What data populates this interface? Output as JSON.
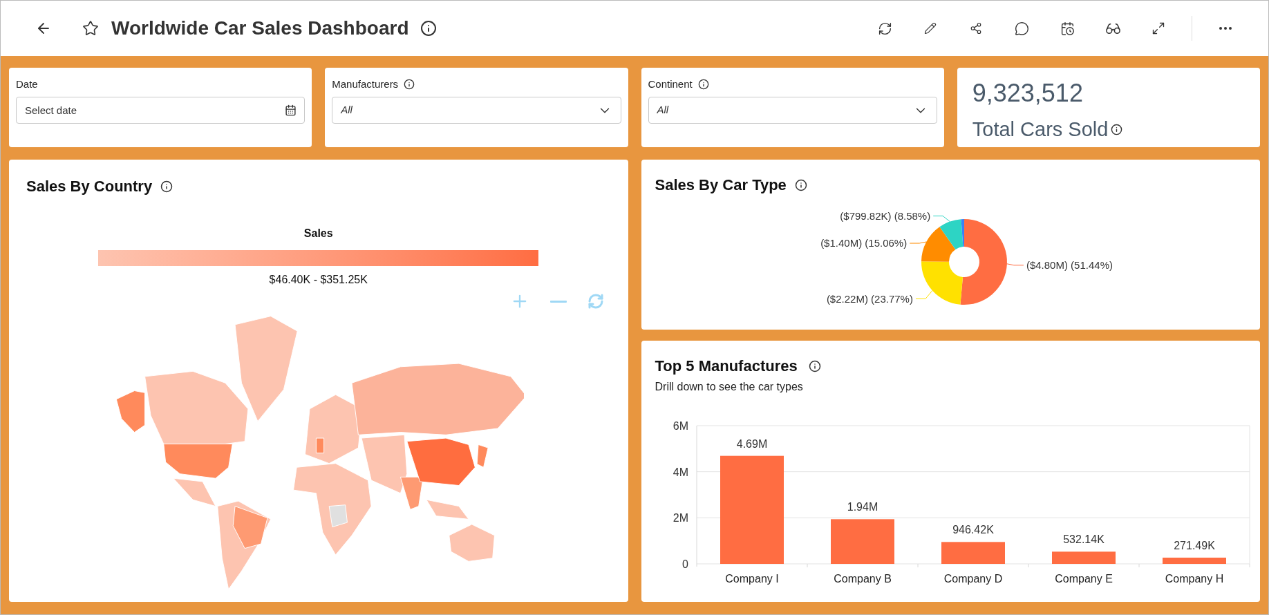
{
  "header": {
    "title": "Worldwide Car Sales Dashboard",
    "favorite": false
  },
  "filters": [
    {
      "kind": "date",
      "label": "Date",
      "placeholder": "Select date",
      "info": false
    },
    {
      "kind": "dropdown",
      "label": "Manufacturers",
      "value": "All",
      "info": true
    },
    {
      "kind": "dropdown",
      "label": "Continent",
      "value": "All",
      "info": true
    }
  ],
  "kpi": {
    "value": "9,323,512",
    "label": "Total Cars Sold"
  },
  "map_card": {
    "title": "Sales By Country",
    "legend_title": "Sales",
    "legend_range": "$46.40K - $351.25K"
  },
  "donut_card": {
    "title": "Sales By Car Type",
    "chart_data": {
      "type": "donut",
      "colors": [
        "#ff6d42",
        "#ffe100",
        "#ff8c00",
        "#2dd4c4",
        "#3b82f6"
      ],
      "values": [
        51.44,
        23.77,
        15.06,
        8.58,
        1.15
      ],
      "value_labels": [
        "($4.80M) (51.44%)",
        "($2.22M) (23.77%)",
        "($1.40M) (15.06%)",
        "($799.82K) (8.58%)",
        null
      ]
    }
  },
  "bar_card": {
    "title": "Top 5 Manufactures",
    "subtitle": "Drill down to see the car types",
    "chart_data": {
      "type": "bar",
      "categories": [
        "Company I",
        "Company B",
        "Company D",
        "Company E",
        "Company H"
      ],
      "series": [
        {
          "color": "#ff6d42",
          "values": [
            4690000,
            1940000,
            950000,
            530000,
            270000
          ]
        }
      ],
      "ylim": [
        0,
        6000000
      ],
      "yticks": [
        {
          "value": 0,
          "label": "0"
        },
        {
          "value": 2000000,
          "label": "2M"
        },
        {
          "value": 4000000,
          "label": "4M"
        },
        {
          "value": 6000000,
          "label": "6M"
        }
      ],
      "value_labels": [
        "4.69M",
        "1.94M",
        "946.42K",
        "532.14K",
        "271.49K"
      ]
    }
  }
}
